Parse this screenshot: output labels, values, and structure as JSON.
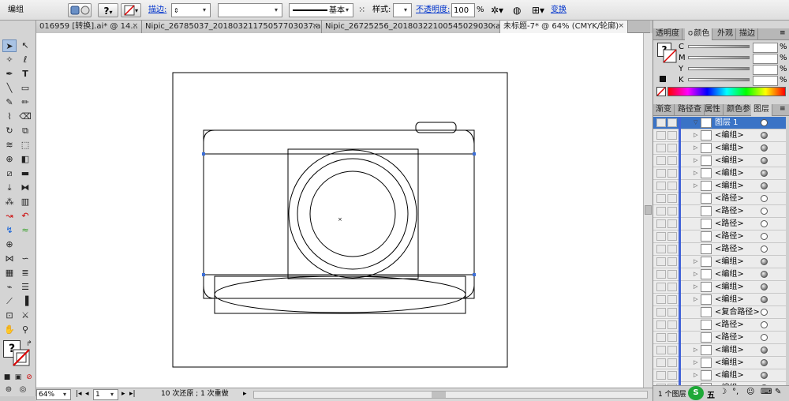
{
  "control_bar": {
    "object_label": "编组",
    "stroke_label": "描边:",
    "stroke_profile": "基本",
    "style_label": "样式:",
    "opacity_label": "不透明度:",
    "opacity_value": "100",
    "opacity_unit": "%",
    "transform_link": "变换",
    "help_glyph": "?"
  },
  "doc_tabs": [
    {
      "label": "016959 [转换].ai* @ 14...",
      "active": false
    },
    {
      "label": "Nipic_26785037_20180321175057703037.ai*",
      "active": false
    },
    {
      "label": "Nipic_26725256_20180322100545029030.ai*",
      "active": false
    },
    {
      "label": "未标题-7* @ 64% (CMYK/轮廓)",
      "active": true
    }
  ],
  "color_panel": {
    "tabs": [
      "透明度",
      "颜色",
      "外观",
      "描边"
    ],
    "active_tab": "颜色",
    "channels": [
      {
        "name": "C",
        "unit": "%"
      },
      {
        "name": "M",
        "unit": "%"
      },
      {
        "name": "Y",
        "unit": "%"
      },
      {
        "name": "K",
        "unit": "%"
      }
    ],
    "help_glyph": "?"
  },
  "layers_panel": {
    "tabs": [
      "渐变",
      "路径查",
      "属性",
      "颜色参",
      "图层"
    ],
    "active_tab": "图层",
    "rows": [
      {
        "label": "图层 1",
        "expander": "▽",
        "target": "hollow",
        "top": true
      },
      {
        "label": "<编组>",
        "expander": "▷",
        "target": "filled"
      },
      {
        "label": "<编组>",
        "expander": "▷",
        "target": "filled"
      },
      {
        "label": "<编组>",
        "expander": "▷",
        "target": "filled"
      },
      {
        "label": "<编组>",
        "expander": "▷",
        "target": "filled"
      },
      {
        "label": "<编组>",
        "expander": "▷",
        "target": "filled"
      },
      {
        "label": "<路径>",
        "expander": "",
        "target": "hollow"
      },
      {
        "label": "<路径>",
        "expander": "",
        "target": "hollow"
      },
      {
        "label": "<路径>",
        "expander": "",
        "target": "hollow"
      },
      {
        "label": "<路径>",
        "expander": "",
        "target": "hollow"
      },
      {
        "label": "<路径>",
        "expander": "",
        "target": "hollow"
      },
      {
        "label": "<编组>",
        "expander": "▷",
        "target": "filled"
      },
      {
        "label": "<编组>",
        "expander": "▷",
        "target": "filled"
      },
      {
        "label": "<编组>",
        "expander": "▷",
        "target": "filled"
      },
      {
        "label": "<编组>",
        "expander": "▷",
        "target": "filled"
      },
      {
        "label": "<复合路径>",
        "expander": "",
        "target": "hollow"
      },
      {
        "label": "<路径>",
        "expander": "",
        "target": "hollow"
      },
      {
        "label": "<路径>",
        "expander": "",
        "target": "hollow"
      },
      {
        "label": "<编组>",
        "expander": "▷",
        "target": "filled"
      },
      {
        "label": "<编组>",
        "expander": "▷",
        "target": "filled"
      },
      {
        "label": "<编组>",
        "expander": "▷",
        "target": "filled"
      },
      {
        "label": "<编组>",
        "expander": "▷",
        "target": "filled"
      }
    ],
    "footer_count": "1 个图层"
  },
  "status_bar": {
    "zoom": "64%",
    "page": "1",
    "status_text": "10 次还原 ; 1 次重做"
  },
  "taskbar": {
    "ime_label": "五"
  },
  "colors": {
    "canvas_bg": "#ffffff",
    "selection_blue": "#3a73c6",
    "layer_bar": "#4263d8",
    "anchor_blue": "#3c6fd8"
  }
}
